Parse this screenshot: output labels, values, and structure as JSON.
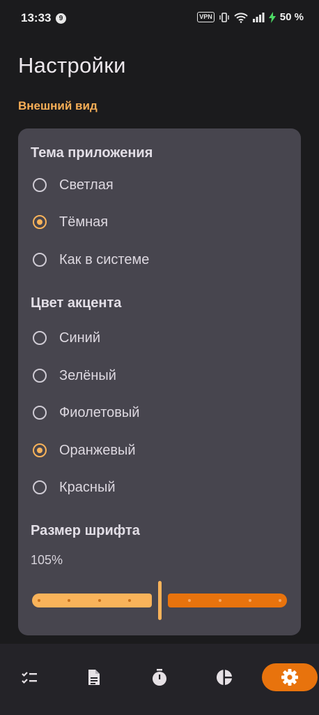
{
  "status_bar": {
    "time": "13:33",
    "notification_count": "9",
    "vpn": "VPN",
    "battery": "50 %"
  },
  "page": {
    "title": "Настройки"
  },
  "section": {
    "label": "Внешний вид"
  },
  "theme": {
    "title": "Тема приложения",
    "options": [
      {
        "label": "Светлая",
        "checked": false
      },
      {
        "label": "Тёмная",
        "checked": true
      },
      {
        "label": "Как в системе",
        "checked": false
      }
    ]
  },
  "accent": {
    "title": "Цвет акцента",
    "options": [
      {
        "label": "Синий",
        "checked": false
      },
      {
        "label": "Зелёный",
        "checked": false
      },
      {
        "label": "Фиолетовый",
        "checked": false
      },
      {
        "label": "Оранжевый",
        "checked": true
      },
      {
        "label": "Красный",
        "checked": false
      }
    ]
  },
  "font_size": {
    "title": "Размер шрифта",
    "value": "105%",
    "fraction": 0.5
  },
  "colors": {
    "accent": "#f9b35a",
    "accent_dark": "#e8730d",
    "card": "#47454e",
    "background": "#1b1b1d"
  },
  "nav": {
    "items": [
      {
        "icon": "checklist-icon",
        "active": false
      },
      {
        "icon": "document-icon",
        "active": false
      },
      {
        "icon": "timer-icon",
        "active": false
      },
      {
        "icon": "pie-chart-icon",
        "active": false
      },
      {
        "icon": "gear-icon",
        "active": true
      }
    ]
  }
}
